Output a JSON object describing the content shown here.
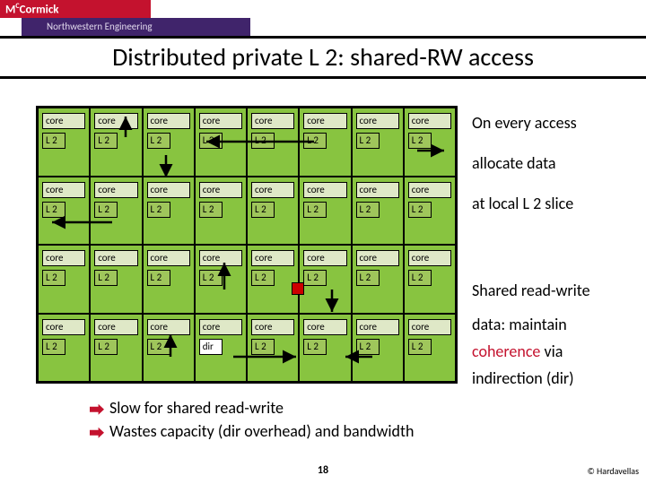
{
  "brand": {
    "main": "M",
    "rest": "Cormick",
    "reg": "C",
    "sub": "Northwestern Engineering"
  },
  "title": "Distributed private L 2: shared-RW access",
  "cell": {
    "core": "core",
    "l2": "L 2",
    "dir": "dir"
  },
  "grid": {
    "rows": 4,
    "cols": 8,
    "dir_cell": {
      "row": 3,
      "col": 3
    }
  },
  "right": {
    "l1": "On every access",
    "l2": "allocate data",
    "l3": "at local L 2 slice",
    "l4": "Shared read-write",
    "l5": "data: maintain",
    "l6": "coherence",
    "l6b": " via",
    "l7": "indirection (dir)"
  },
  "bullets": {
    "b1": "Slow for shared read-write",
    "b2": "Wastes capacity (dir overhead) and bandwidth"
  },
  "page": "18",
  "credit": "© Hardavellas"
}
